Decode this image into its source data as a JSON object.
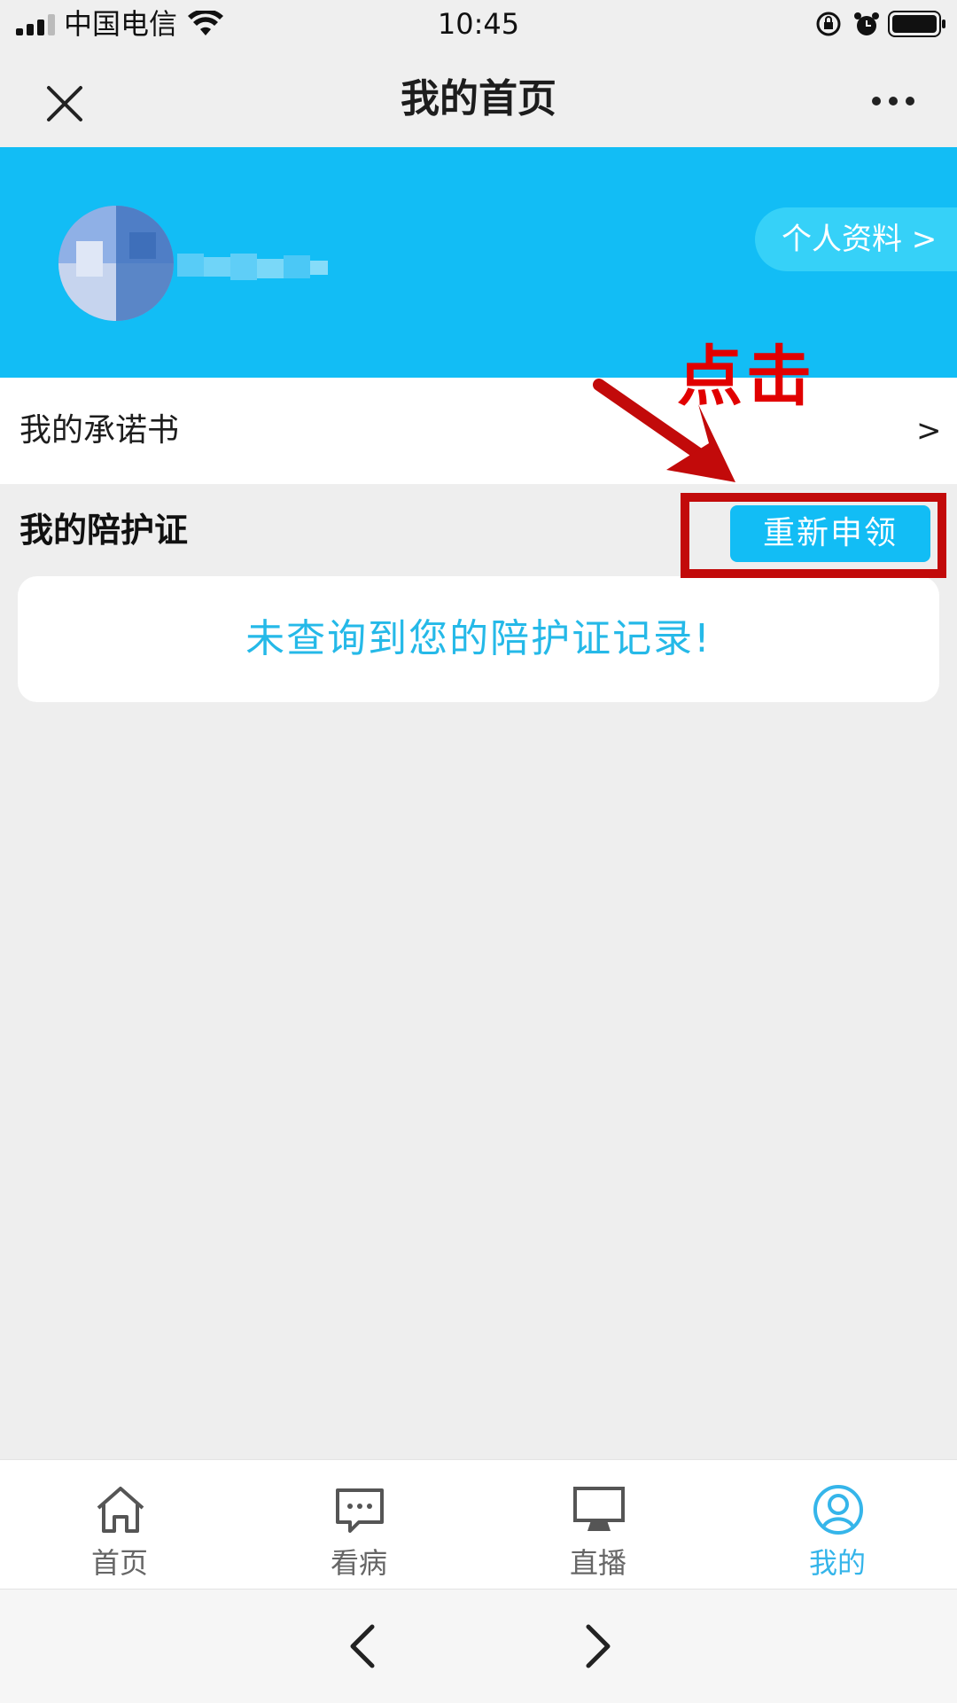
{
  "status_bar": {
    "carrier": "中国电信",
    "time": "10:45"
  },
  "nav": {
    "title": "我的首页"
  },
  "profile": {
    "button_label": "个人资料 >"
  },
  "pledge": {
    "label": "我的承诺书",
    "chevron": ">"
  },
  "escort_cert": {
    "title": "我的陪护证",
    "reapply_label": "重新申领",
    "empty_message": "未查询到您的陪护证记录!"
  },
  "annotation": {
    "text": "点击"
  },
  "tabs": [
    {
      "label": "首页",
      "icon": "home-icon"
    },
    {
      "label": "看病",
      "icon": "chat-icon"
    },
    {
      "label": "直播",
      "icon": "monitor-icon"
    },
    {
      "label": "我的",
      "icon": "user-icon"
    }
  ],
  "active_tab": "我的",
  "colors": {
    "brand_blue": "#12bdf5",
    "annotation_red": "#c20a0a",
    "active_tab": "#35b5ea"
  }
}
